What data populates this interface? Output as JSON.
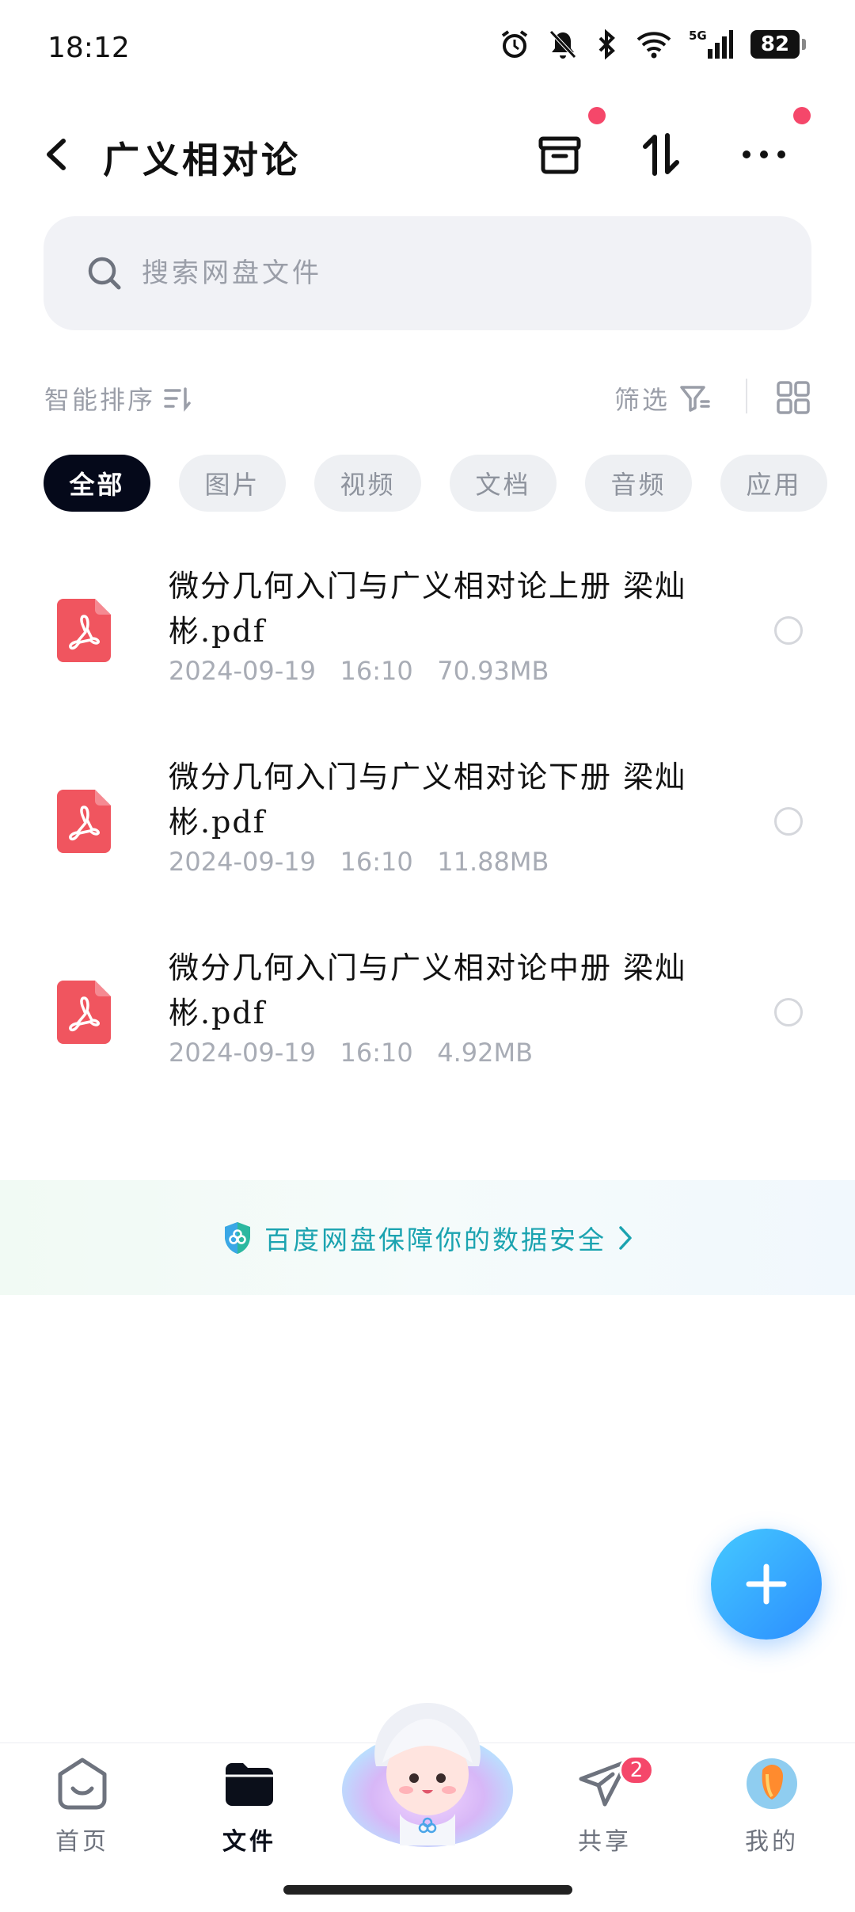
{
  "status_bar": {
    "time": "18:12",
    "network": "5G",
    "battery": "82"
  },
  "header": {
    "title": "广义相对论",
    "back_icon": "chevron-left-icon",
    "actions": [
      "archive-icon",
      "sort-icon",
      "more-icon"
    ]
  },
  "search": {
    "placeholder": "搜索网盘文件"
  },
  "toolbar": {
    "smart_sort_label": "智能排序",
    "filter_label": "筛选"
  },
  "tabs": [
    {
      "label": "全部",
      "active": true
    },
    {
      "label": "图片",
      "active": false
    },
    {
      "label": "视频",
      "active": false
    },
    {
      "label": "文档",
      "active": false
    },
    {
      "label": "音频",
      "active": false
    },
    {
      "label": "应用",
      "active": false
    }
  ],
  "files": [
    {
      "name": "微分几何入门与广义相对论上册 梁灿彬.pdf",
      "date": "2024-09-19",
      "time": "16:10",
      "size": "70.93MB",
      "icon": "pdf-icon"
    },
    {
      "name": "微分几何入门与广义相对论下册 梁灿彬.pdf",
      "date": "2024-09-19",
      "time": "16:10",
      "size": "11.88MB",
      "icon": "pdf-icon"
    },
    {
      "name": "微分几何入门与广义相对论中册 梁灿彬.pdf",
      "date": "2024-09-19",
      "time": "16:10",
      "size": "4.92MB",
      "icon": "pdf-icon"
    }
  ],
  "security_banner": {
    "text": "百度网盘保障你的数据安全"
  },
  "bottom_nav": {
    "home": "首页",
    "files": "文件",
    "share": "共享",
    "me": "我的",
    "share_badge": "2"
  },
  "colors": {
    "accent": "#2b8dff",
    "badge": "#f5476a",
    "pdf": "#f0555f",
    "security_text": "#1ba3b0"
  }
}
